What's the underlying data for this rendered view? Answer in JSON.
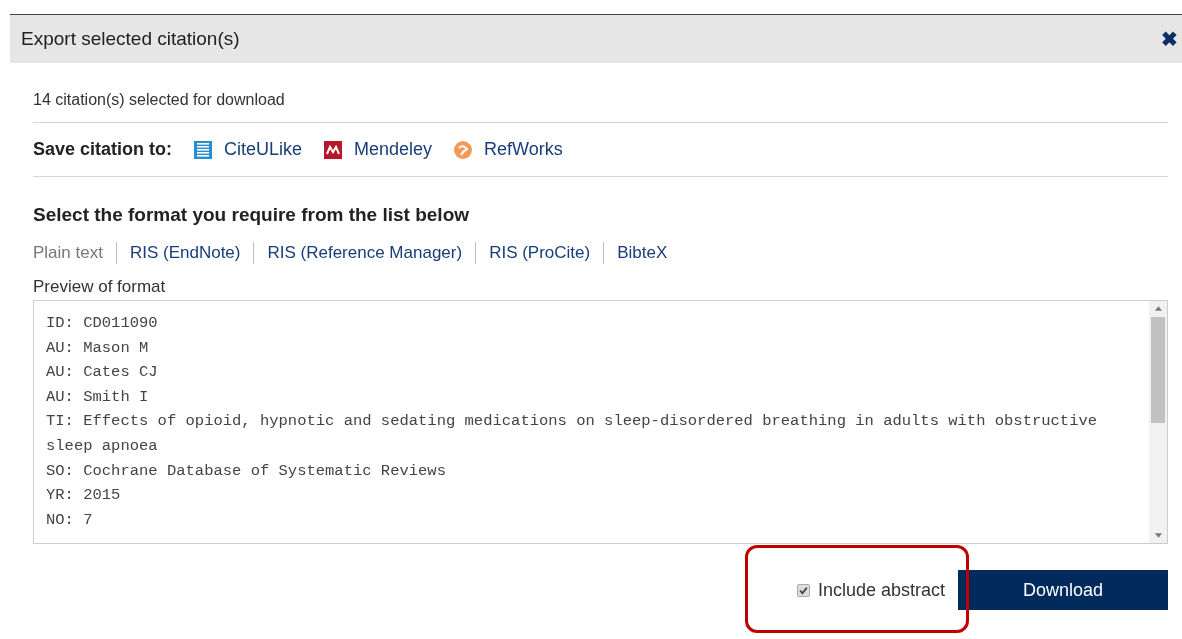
{
  "dialog": {
    "title": "Export selected citation(s)",
    "close": "✖"
  },
  "selection_count": "14 citation(s) selected for download",
  "save_to": {
    "label": "Save citation to:",
    "services": [
      {
        "kind": "citeulike",
        "label": "CiteULike"
      },
      {
        "kind": "mendeley",
        "label": "Mendeley"
      },
      {
        "kind": "refworks",
        "label": "RefWorks"
      }
    ]
  },
  "format_heading": "Select the format you require from the list below",
  "formats": [
    {
      "label": "Plain text",
      "selected": true
    },
    {
      "label": "RIS (EndNote)",
      "selected": false
    },
    {
      "label": "RIS (Reference Manager)",
      "selected": false
    },
    {
      "label": "RIS (ProCite)",
      "selected": false
    },
    {
      "label": "BibteX",
      "selected": false
    }
  ],
  "preview": {
    "label": "Preview of format",
    "lines": [
      "ID: CD011090",
      "AU: Mason M",
      "AU: Cates CJ",
      "AU: Smith I",
      "TI: Effects of opioid, hypnotic and sedating medications on sleep-disordered breathing in adults with obstructive sleep apnoea",
      "SO: Cochrane Database of Systematic Reviews",
      "YR: 2015",
      "NO: 7"
    ]
  },
  "include_abstract": {
    "label": "Include abstract",
    "checked": true
  },
  "download_button": "Download"
}
